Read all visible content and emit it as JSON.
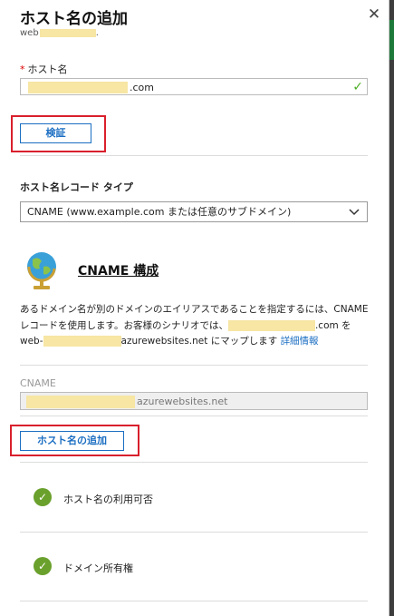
{
  "panel": {
    "title": "ホスト名の追加",
    "subtitle_prefix": "web",
    "subtitle_suffix": "."
  },
  "hostname": {
    "label": "ホスト名",
    "required_mark": "*",
    "value_suffix": ".com"
  },
  "verify_button": {
    "label": "検証"
  },
  "record_type": {
    "label": "ホスト名レコード タイプ",
    "selected": "CNAME (www.example.com または任意のサブドメイン)"
  },
  "cname_section": {
    "title": "CNAME 構成",
    "description_1": "あるドメイン名が別のドメインのエイリアスであることを指定するには、CNAME レコードを使用します。お客様のシナリオでは、",
    "description_2": ".com を web-",
    "description_3": "azurewebsites.net にマップします",
    "more_info_link": "詳細情報",
    "field_label": "CNAME",
    "field_value_suffix": "azurewebsites.net"
  },
  "add_button": {
    "label": "ホスト名の追加"
  },
  "checks": [
    {
      "label": "ホスト名の利用可否"
    },
    {
      "label": "ドメイン所有権"
    }
  ],
  "icons": {
    "close": "close-icon",
    "valid": "checkmark-icon",
    "dropdown": "chevron-down-icon",
    "globe": "globe-icon",
    "status": "checkmark-circle-icon"
  },
  "colors": {
    "link_blue": "#1b6ec2",
    "highlight_red": "#d9202c",
    "success_green": "#6aa02c",
    "redaction_yellow": "#f7e6a4"
  }
}
